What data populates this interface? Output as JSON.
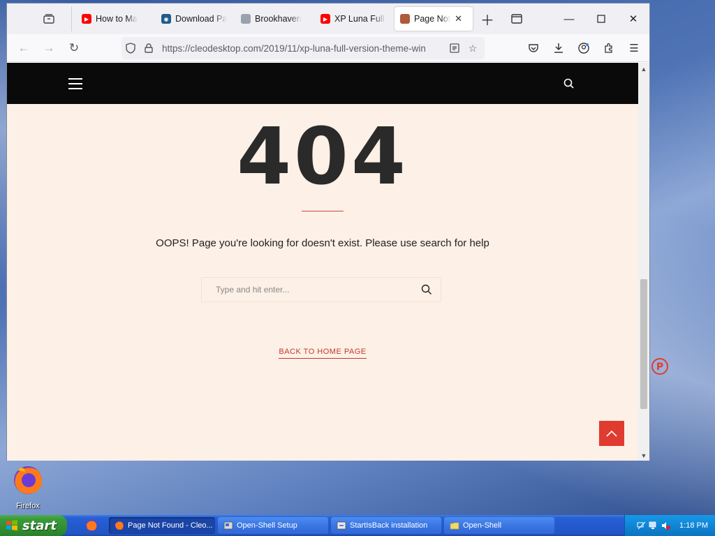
{
  "browser": {
    "tabs": [
      {
        "label": "How to Ma",
        "icon": "youtube-icon",
        "color": "#ff0000",
        "active": false
      },
      {
        "label": "Download Pa",
        "icon": "site-icon",
        "color": "#1f5c8c",
        "active": false
      },
      {
        "label": "Brookhaven",
        "icon": "image-icon",
        "color": "#8a8a8a",
        "active": false
      },
      {
        "label": "XP Luna Full V",
        "icon": "youtube-icon",
        "color": "#ff0000",
        "active": false
      },
      {
        "label": "Page Not",
        "icon": "page-icon",
        "color": "#b05a3c",
        "active": true
      }
    ],
    "url": "https://cleodesktop.com/2019/11/xp-luna-full-version-theme-win"
  },
  "page": {
    "error_code": "404",
    "message": "OOPS! Page you're looking for doesn't exist. Please use search for help",
    "search_placeholder": "Type and hit enter...",
    "home_link": "BACK TO HOME PAGE",
    "accent_color": "#e03b30",
    "bg_color": "#fdf0e6"
  },
  "desktop": {
    "icon_label": "Firefox"
  },
  "taskbar": {
    "start_label": "start",
    "tasks": [
      {
        "label": "Page Not Found - Cleo...",
        "icon": "firefox-icon",
        "active": true
      },
      {
        "label": "Open-Shell Setup",
        "icon": "setup-icon",
        "active": false
      },
      {
        "label": "StartIsBack installation",
        "icon": "install-icon",
        "active": false
      },
      {
        "label": "Open-Shell",
        "icon": "folder-icon",
        "active": false
      }
    ],
    "clock": "1:18 PM"
  }
}
